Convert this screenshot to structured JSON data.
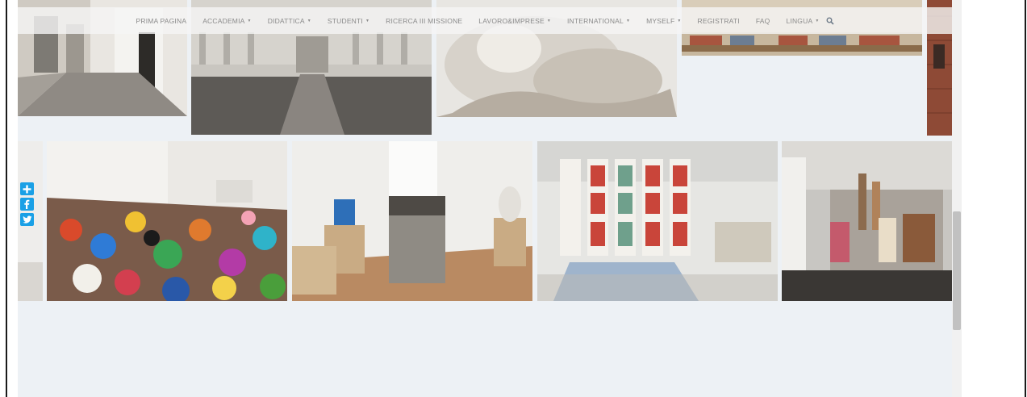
{
  "navbar": {
    "items": [
      {
        "label": "PRIMA PAGINA",
        "dropdown": false
      },
      {
        "label": "ACCADEMIA",
        "dropdown": true
      },
      {
        "label": "DIDATTICA",
        "dropdown": true
      },
      {
        "label": "STUDENTI",
        "dropdown": true
      },
      {
        "label": "RICERCA III MISSIONE",
        "dropdown": false
      },
      {
        "label": "LAVORO&IMPRESE",
        "dropdown": true
      },
      {
        "label": "INTERNATIONAL",
        "dropdown": true
      },
      {
        "label": "MYSELF",
        "dropdown": true
      },
      {
        "label": "REGISTRATI",
        "dropdown": false
      },
      {
        "label": "FAQ",
        "dropdown": false
      },
      {
        "label": "LINGUA",
        "dropdown": true
      }
    ],
    "caret_glyph": "▼",
    "search_icon": "search-icon"
  },
  "share": {
    "buttons": [
      {
        "name": "share-plus-button",
        "icon": "plus-icon"
      },
      {
        "name": "share-facebook-button",
        "icon": "facebook-icon"
      },
      {
        "name": "share-twitter-button",
        "icon": "twitter-icon"
      }
    ],
    "color": "#1aa0e6"
  },
  "gallery": {
    "row1": [
      "corridor-photo",
      "courtyard-photo",
      "sculpture-photo",
      "books-photo",
      "brick-photo"
    ],
    "row2": [
      "plastic-floor-installation-photo",
      "stone-sculpture-studio-photo",
      "prints-exhibition-photo",
      "fashion-exhibition-photo"
    ]
  },
  "colors": {
    "page_bg": "#edf1f5",
    "nav_text": "#8a8a8a",
    "share": "#1aa0e6"
  }
}
